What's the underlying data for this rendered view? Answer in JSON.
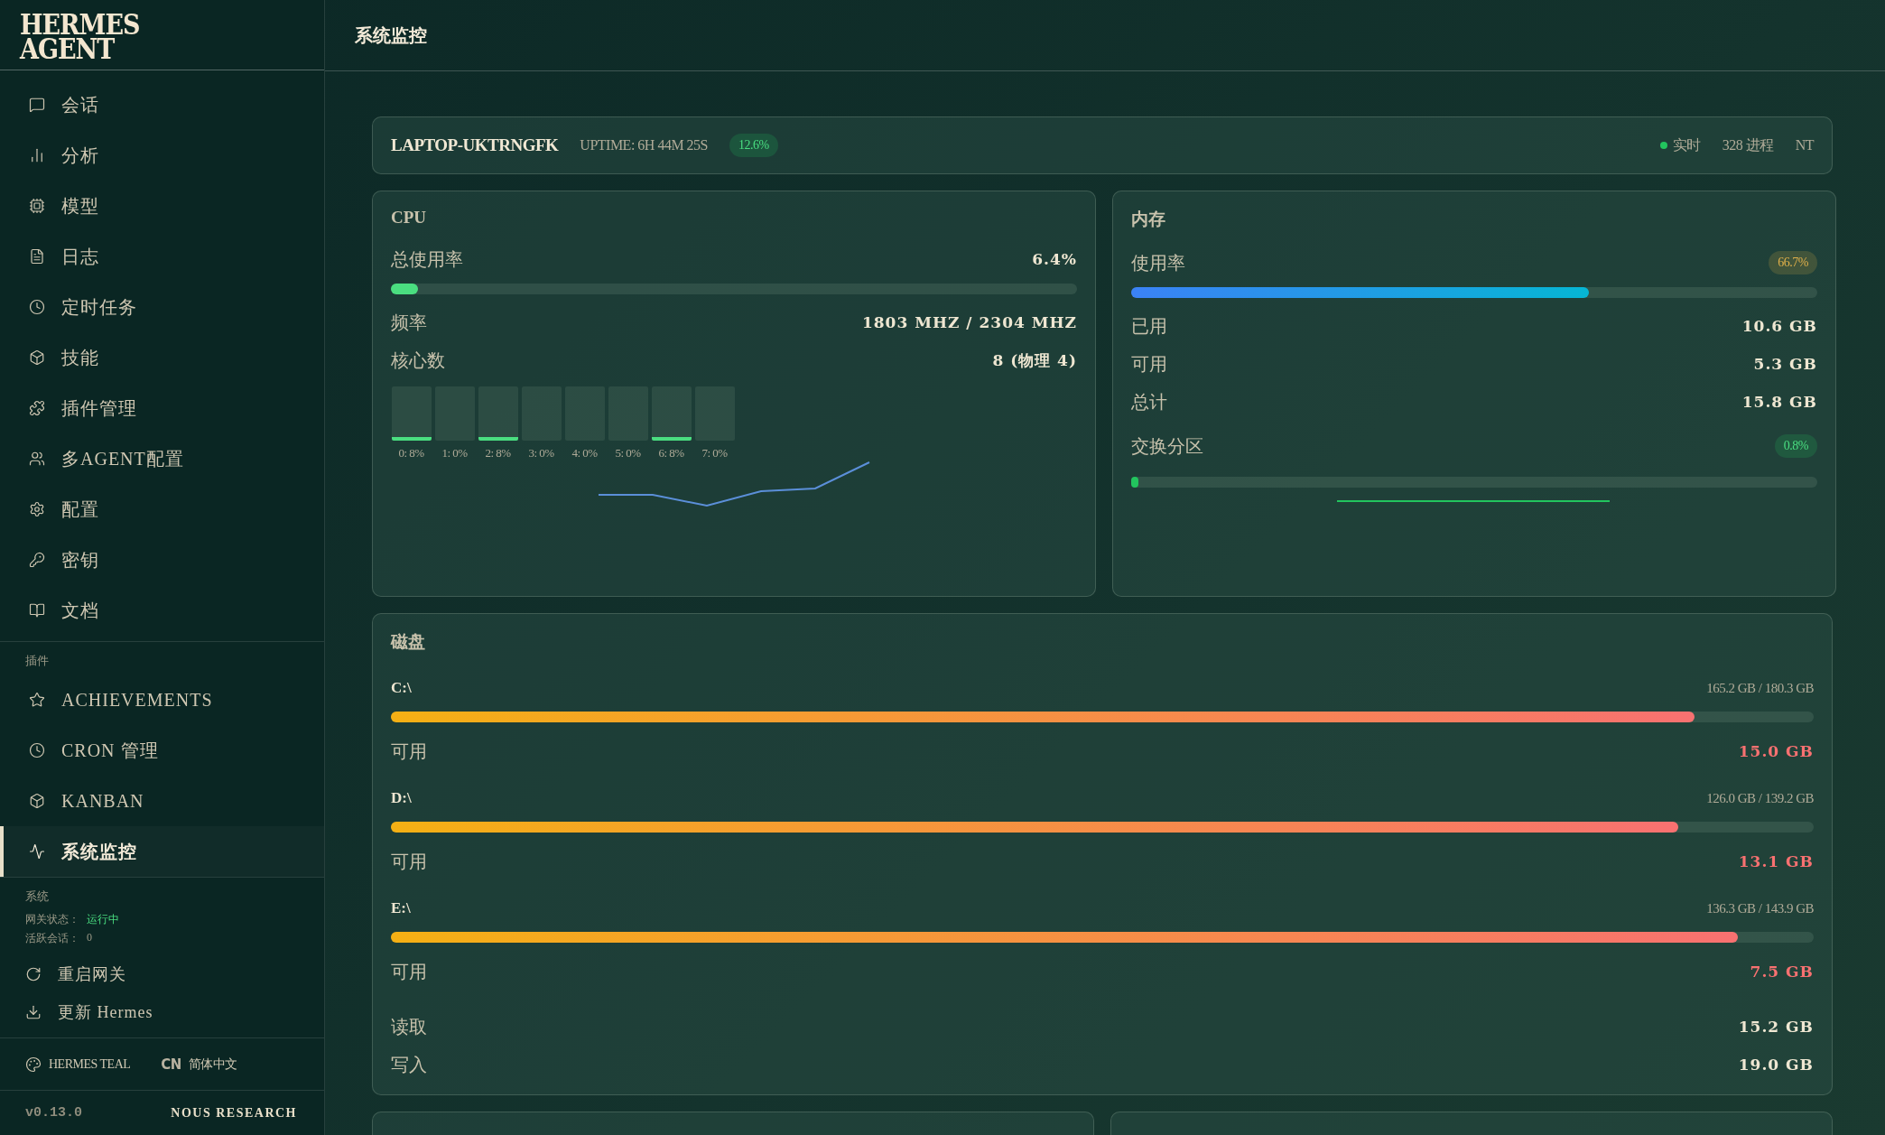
{
  "sidebar": {
    "logo": [
      "HERMES",
      "AGENT"
    ],
    "nav": [
      {
        "label": "会话",
        "selected": false
      },
      {
        "label": "分析",
        "selected": false
      },
      {
        "label": "模型",
        "selected": false
      },
      {
        "label": "日志",
        "selected": false
      },
      {
        "label": "定时任务",
        "selected": false
      },
      {
        "label": "技能",
        "selected": false
      },
      {
        "label": "插件管理",
        "selected": false
      },
      {
        "label": "多AGENT配置",
        "selected": false
      },
      {
        "label": "配置",
        "selected": false
      },
      {
        "label": "密钥",
        "selected": false
      },
      {
        "label": "文档",
        "selected": false
      }
    ],
    "plugins_heading": "插件",
    "plugins": [
      {
        "label": "ACHIEVEMENTS",
        "selected": false
      },
      {
        "label": "CRON 管理",
        "selected": false
      },
      {
        "label": "KANBAN",
        "selected": false
      },
      {
        "label": "系统监控",
        "selected": true
      }
    ],
    "system": {
      "heading": "系统",
      "gateway_label": "网关状态：",
      "gateway_value": "运行中",
      "sessions_label": "活跃会话：",
      "sessions_value": "0"
    },
    "actions": [
      "重启网关",
      "更新 Hermes"
    ],
    "theme": "HERMES TEAL",
    "lang_code": "CN",
    "lang": "简体中文",
    "version": "v0.13.0",
    "brand": "NOUS RESEARCH"
  },
  "header": {
    "title": "系统监控"
  },
  "host": {
    "name": "LAPTOP-UKTRNGFK",
    "uptime": "UPTIME: 6H 44M 25S",
    "load": "12.6%",
    "live": "实时",
    "processes": "328 进程",
    "os": "NT"
  },
  "cpu": {
    "title": "CPU",
    "usage_label": "总使用率",
    "usage": "6.4%",
    "level": 0.04,
    "freq_label": "频率",
    "freq": "1803 MHZ / 2304 MHZ",
    "cores_label": "核心数",
    "cores": "8 (物理 4)",
    "core_bars": [
      {
        "label": "0: 8%",
        "active": true
      },
      {
        "label": "1: 0%",
        "active": false
      },
      {
        "label": "2: 8%",
        "active": true
      },
      {
        "label": "3: 0%",
        "active": false
      },
      {
        "label": "4: 0%",
        "active": false
      },
      {
        "label": "5: 0%",
        "active": false
      },
      {
        "label": "6: 8%",
        "active": true
      },
      {
        "label": "7: 0%",
        "active": false
      }
    ]
  },
  "memory": {
    "title": "内存",
    "usage_label": "使用率",
    "usage": "66.7%",
    "level": 0.667,
    "rows": [
      {
        "label": "已用",
        "value": "10.6 GB"
      },
      {
        "label": "可用",
        "value": "5.3 GB"
      },
      {
        "label": "总计",
        "value": "15.8 GB"
      }
    ],
    "swap": {
      "label": "交换分区",
      "value": "0.8%",
      "level": 0.008
    }
  },
  "disk": {
    "title": "磁盘",
    "drives": [
      {
        "name": "C:\\",
        "usage": "165.2 GB / 180.3 GB",
        "level": 0.916,
        "avail_label": "可用",
        "free": "15.0 GB"
      },
      {
        "name": "D:\\",
        "usage": "126.0 GB / 139.2 GB",
        "level": 0.905,
        "avail_label": "可用",
        "free": "13.1 GB"
      },
      {
        "name": "E:\\",
        "usage": "136.3 GB / 143.9 GB",
        "level": 0.947,
        "avail_label": "可用",
        "free": "7.5 GB"
      }
    ],
    "io": [
      {
        "label": "读取",
        "value": "15.2 GB"
      },
      {
        "label": "写入",
        "value": "19.0 GB"
      }
    ]
  }
}
